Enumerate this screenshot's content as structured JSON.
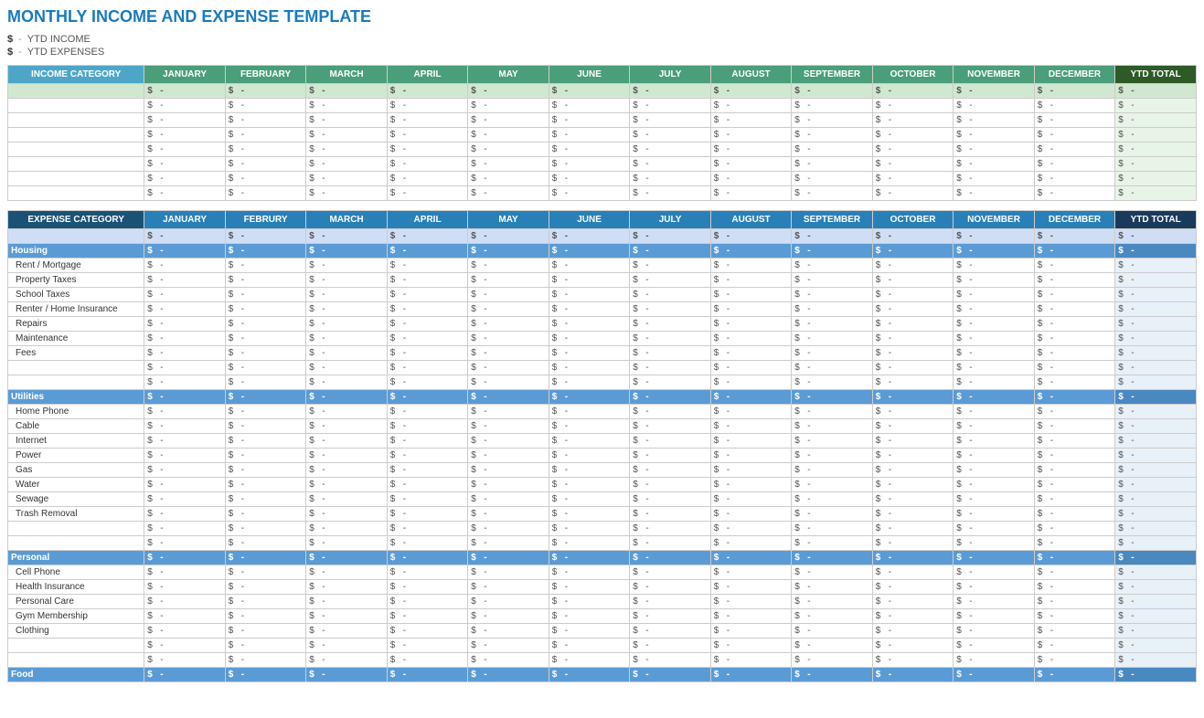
{
  "title": "MONTHLY INCOME AND EXPENSE TEMPLATE",
  "ytd_summary": {
    "income_label": "YTD INCOME",
    "expense_label": "YTD EXPENSES",
    "income_value": "$",
    "expense_value": "$",
    "income_amount": "-",
    "expense_amount": "-"
  },
  "months": [
    "JANUARY",
    "FEBRUARY",
    "MARCH",
    "APRIL",
    "MAY",
    "JUNE",
    "JULY",
    "AUGUST",
    "SEPTEMBER",
    "OCTOBER",
    "NOVEMBER",
    "DECEMBER"
  ],
  "income_section": {
    "category_header": "INCOME CATEGORY",
    "ytd_header": "YTD TOTAL",
    "total_row": {
      "dollar": "$",
      "dash": "-"
    },
    "rows": [
      {
        "category": "",
        "values": []
      },
      {
        "category": "",
        "values": []
      },
      {
        "category": "",
        "values": []
      },
      {
        "category": "",
        "values": []
      },
      {
        "category": "",
        "values": []
      },
      {
        "category": "",
        "values": []
      },
      {
        "category": "",
        "values": []
      }
    ]
  },
  "expense_section": {
    "category_header": "EXPENSE CATEGORY",
    "ytd_header": "YTD TOTAL",
    "total_row": {
      "dollar": "$",
      "dash": "-"
    },
    "sections": [
      {
        "name": "Housing",
        "items": [
          "Rent / Mortgage",
          "Property Taxes",
          "School Taxes",
          "Renter / Home Insurance",
          "Repairs",
          "Maintenance",
          "Fees",
          "",
          ""
        ]
      },
      {
        "name": "Utilities",
        "items": [
          "Home Phone",
          "Cable",
          "Internet",
          "Power",
          "Gas",
          "Water",
          "Sewage",
          "Trash Removal",
          "",
          ""
        ]
      },
      {
        "name": "Personal",
        "items": [
          "Cell Phone",
          "Health Insurance",
          "Personal Care",
          "Gym Membership",
          "Clothing",
          "",
          ""
        ]
      },
      {
        "name": "Food",
        "items": []
      }
    ]
  },
  "empty_dollar": "$",
  "empty_dash": "-"
}
